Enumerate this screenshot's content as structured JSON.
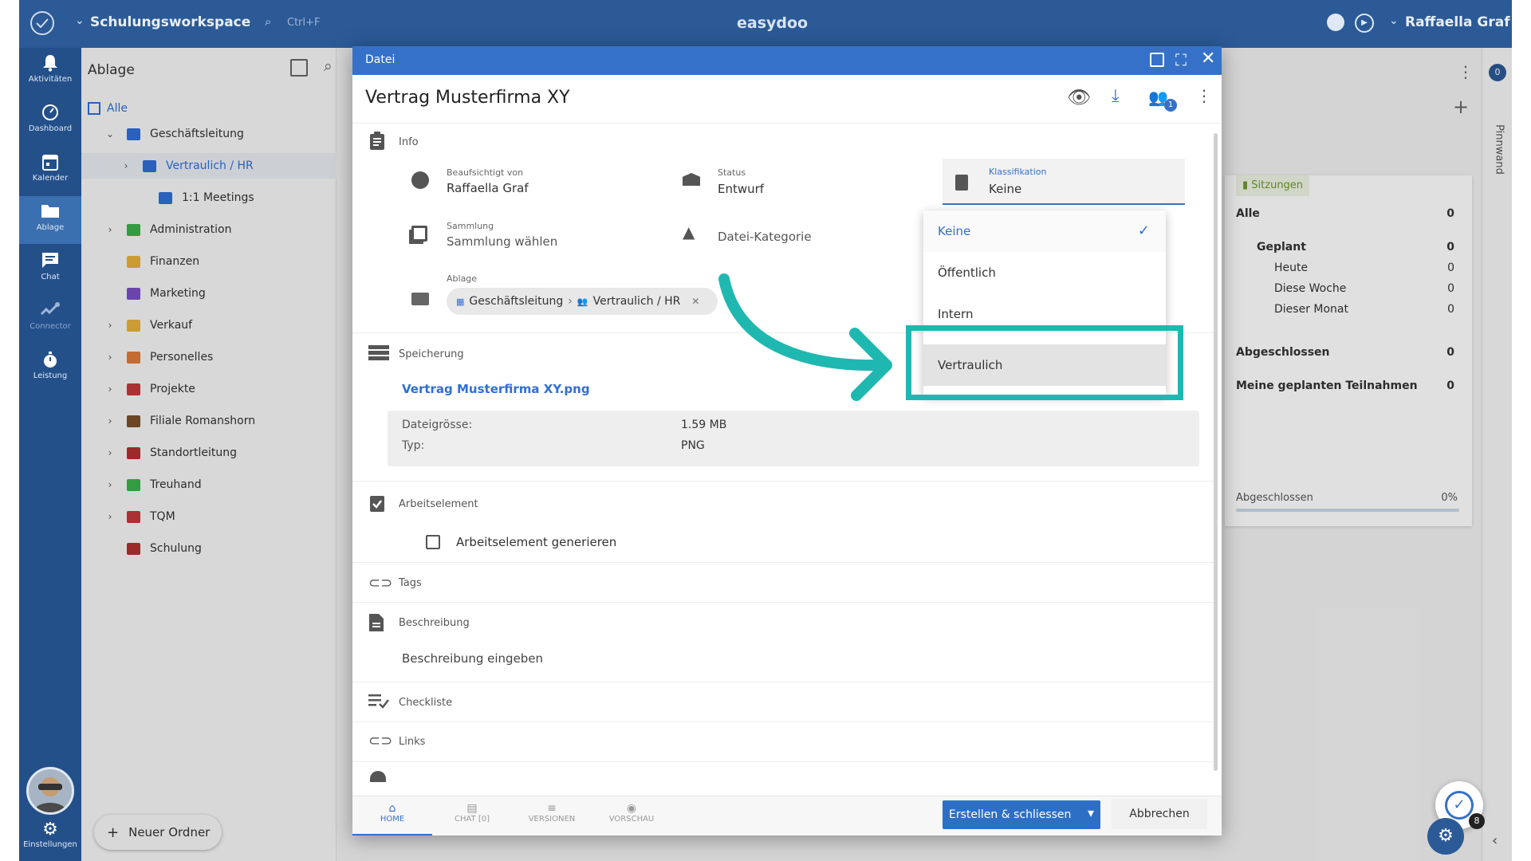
{
  "topbar": {
    "workspace": "Schulungsworkspace",
    "search_shortcut": "Ctrl+F",
    "app_name": "easydoo",
    "user": "Raffaella Graf"
  },
  "nav": [
    {
      "label": "Aktivitäten",
      "icon": "bell-icon"
    },
    {
      "label": "Dashboard",
      "icon": "speedometer-icon"
    },
    {
      "label": "Kalender",
      "icon": "calendar-icon"
    },
    {
      "label": "Ablage",
      "icon": "folder-icon",
      "active": true
    },
    {
      "label": "Chat",
      "icon": "chat-icon"
    },
    {
      "label": "Connector",
      "icon": "connector-icon"
    },
    {
      "label": "Leistung",
      "icon": "stopwatch-icon"
    }
  ],
  "settings_label": "Einstellungen",
  "panel": {
    "title": "Ablage",
    "all": "Alle",
    "tree": [
      {
        "label": "Geschäftsleitung",
        "level": 0,
        "expanded": true,
        "color": "#2f6fd6"
      },
      {
        "label": "Vertraulich / HR",
        "level": 1,
        "active": true,
        "color": "#2f6fd6"
      },
      {
        "label": "1:1 Meetings",
        "level": 2,
        "color": "#2f6fd6"
      },
      {
        "label": "Administration",
        "level": 0,
        "color": "#3bb24a"
      },
      {
        "label": "Finanzen",
        "level": 0,
        "color": "#e7b23c"
      },
      {
        "label": "Marketing",
        "level": 0,
        "color": "#7b4fc4"
      },
      {
        "label": "Verkauf",
        "level": 0,
        "color": "#e7b23c"
      },
      {
        "label": "Personelles",
        "level": 0,
        "color": "#e07a3a"
      },
      {
        "label": "Projekte",
        "level": 0,
        "color": "#c23a3a"
      },
      {
        "label": "Filiale Romanshorn",
        "level": 0,
        "color": "#7a4f2a"
      },
      {
        "label": "Standortleitung",
        "level": 0,
        "color": "#b33030"
      },
      {
        "label": "Treuhand",
        "level": 0,
        "color": "#3bb24a"
      },
      {
        "label": "TQM",
        "level": 0,
        "color": "#c23a3a"
      },
      {
        "label": "Schulung",
        "level": 0,
        "color": "#b33030"
      }
    ],
    "new_folder": "Neuer Ordner"
  },
  "dialog": {
    "header": "Datei",
    "title": "Vertrag Musterfirma XY",
    "share_badge": "1",
    "info_label": "Info",
    "supervised_label": "Beaufsichtigt von",
    "supervised_value": "Raffaella Graf",
    "status_label": "Status",
    "status_value": "Entwurf",
    "class_label": "Klassifikation",
    "class_value": "Keine",
    "collection_label": "Sammlung",
    "collection_value": "Sammlung wählen",
    "category_value": "Datei-Kategorie",
    "ablage_label": "Ablage",
    "path_part1": "Geschäftsleitung",
    "path_part2": "Vertraulich / HR",
    "storage_label": "Speicherung",
    "file_name": "Vertrag Musterfirma XY.png",
    "size_label": "Dateigrösse:",
    "size_value": "1.59 MB",
    "type_label": "Typ:",
    "type_value": "PNG",
    "work_label": "Arbeitselement",
    "work_checkbox": "Arbeitselement generieren",
    "tags_label": "Tags",
    "desc_label": "Beschreibung",
    "desc_placeholder": "Beschreibung eingeben",
    "checklist_label": "Checkliste",
    "links_label": "Links",
    "tabs": [
      "HOME",
      "CHAT [0]",
      "VERSIONEN",
      "VORSCHAU"
    ],
    "create_btn": "Erstellen & schliessen",
    "cancel_btn": "Abbrechen"
  },
  "dropdown": {
    "options": [
      "Keine",
      "Öffentlich",
      "Intern",
      "Vertraulich"
    ],
    "selected": "Keine",
    "highlighted": "Vertraulich"
  },
  "sidebar2": {
    "header": "Sitzungen",
    "rows": [
      {
        "label": "Alle",
        "count": "0"
      },
      {
        "label": "Geplant",
        "count": "0"
      },
      {
        "label": "Heute",
        "count": "0"
      },
      {
        "label": "Diese Woche",
        "count": "0"
      },
      {
        "label": "Dieser Monat",
        "count": "0"
      },
      {
        "label": "Abgeschlossen",
        "count": "0"
      },
      {
        "label": "Meine geplanten Teilnahmen",
        "count": "0"
      }
    ],
    "footer_label": "Abgeschlossen",
    "footer_value": "0%"
  },
  "pinnwand": "Pinnwand",
  "pin_badge": "0",
  "fab_badge": "8",
  "colors": {
    "topbar": "#2b5a97",
    "accent": "#3571c8",
    "highlight": "#1fb8b0"
  }
}
